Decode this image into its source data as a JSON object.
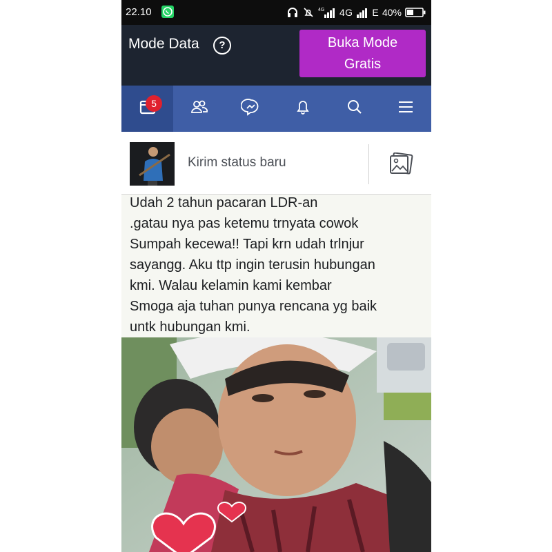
{
  "status_bar": {
    "time": "22.10",
    "network": "4G",
    "network_2": "E",
    "battery": "40%",
    "icons": [
      "whatsapp-icon",
      "headphones-icon",
      "mute-icon",
      "signal-icon",
      "battery-icon"
    ]
  },
  "data_mode": {
    "label": "Mode Data",
    "help_glyph": "?",
    "free_button": [
      "Buka Mode",
      "Gratis"
    ]
  },
  "nav": {
    "notification_count": "5",
    "items": [
      "feed-icon",
      "friends-icon",
      "messenger-icon",
      "notifications-icon",
      "search-icon",
      "menu-icon"
    ]
  },
  "composer": {
    "placeholder": "Kirim status baru"
  },
  "post": {
    "text": "Udah 2 tahun pacaran LDR-an\n.gatau nya pas ketemu trnyata cowok\nSumpah kecewa!!  Tapi krn udah trlnjur\nsayangg.  Aku ttp ingin terusin hubungan\nkmi. Walau kelamin kami kembar\nSmoga aja tuhan punya rencana yg baik\nuntk hubungan kmi."
  },
  "colors": {
    "nav_blue": "#3f5ea6",
    "data_bar": "#1d2430",
    "free_button": "#b02ac6",
    "badge_red": "#e0212e"
  }
}
